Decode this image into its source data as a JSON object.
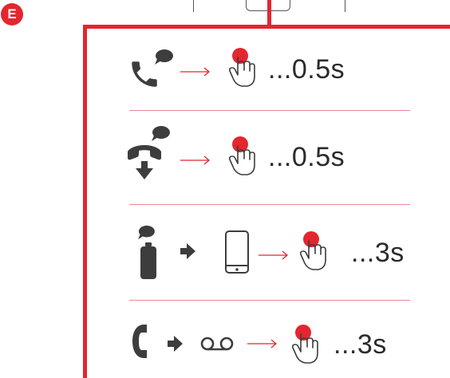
{
  "section": {
    "badge_label": "E"
  },
  "colors": {
    "accent": "#e3262f",
    "icon": "#3d3d3d",
    "divider": "#e88a8e"
  },
  "steps": [
    {
      "icons": [
        "incoming-call-icon",
        "speech-bubble-icon",
        "arrow-right-icon",
        "tap-hand-icon"
      ],
      "duration": "...0.5s"
    },
    {
      "icons": [
        "hang-up-call-icon",
        "speech-bubble-icon",
        "arrow-right-icon",
        "tap-hand-icon"
      ],
      "duration": "...0.5s"
    },
    {
      "icons": [
        "battery-icon",
        "speech-bubble-icon",
        "arrow-right-icon",
        "phone-icon",
        "tap-hand-icon"
      ],
      "duration": "...3s"
    },
    {
      "icons": [
        "handset-icon",
        "arrow-right-icon",
        "voicemail-icon",
        "tap-hand-icon"
      ],
      "duration": "...3s"
    }
  ]
}
